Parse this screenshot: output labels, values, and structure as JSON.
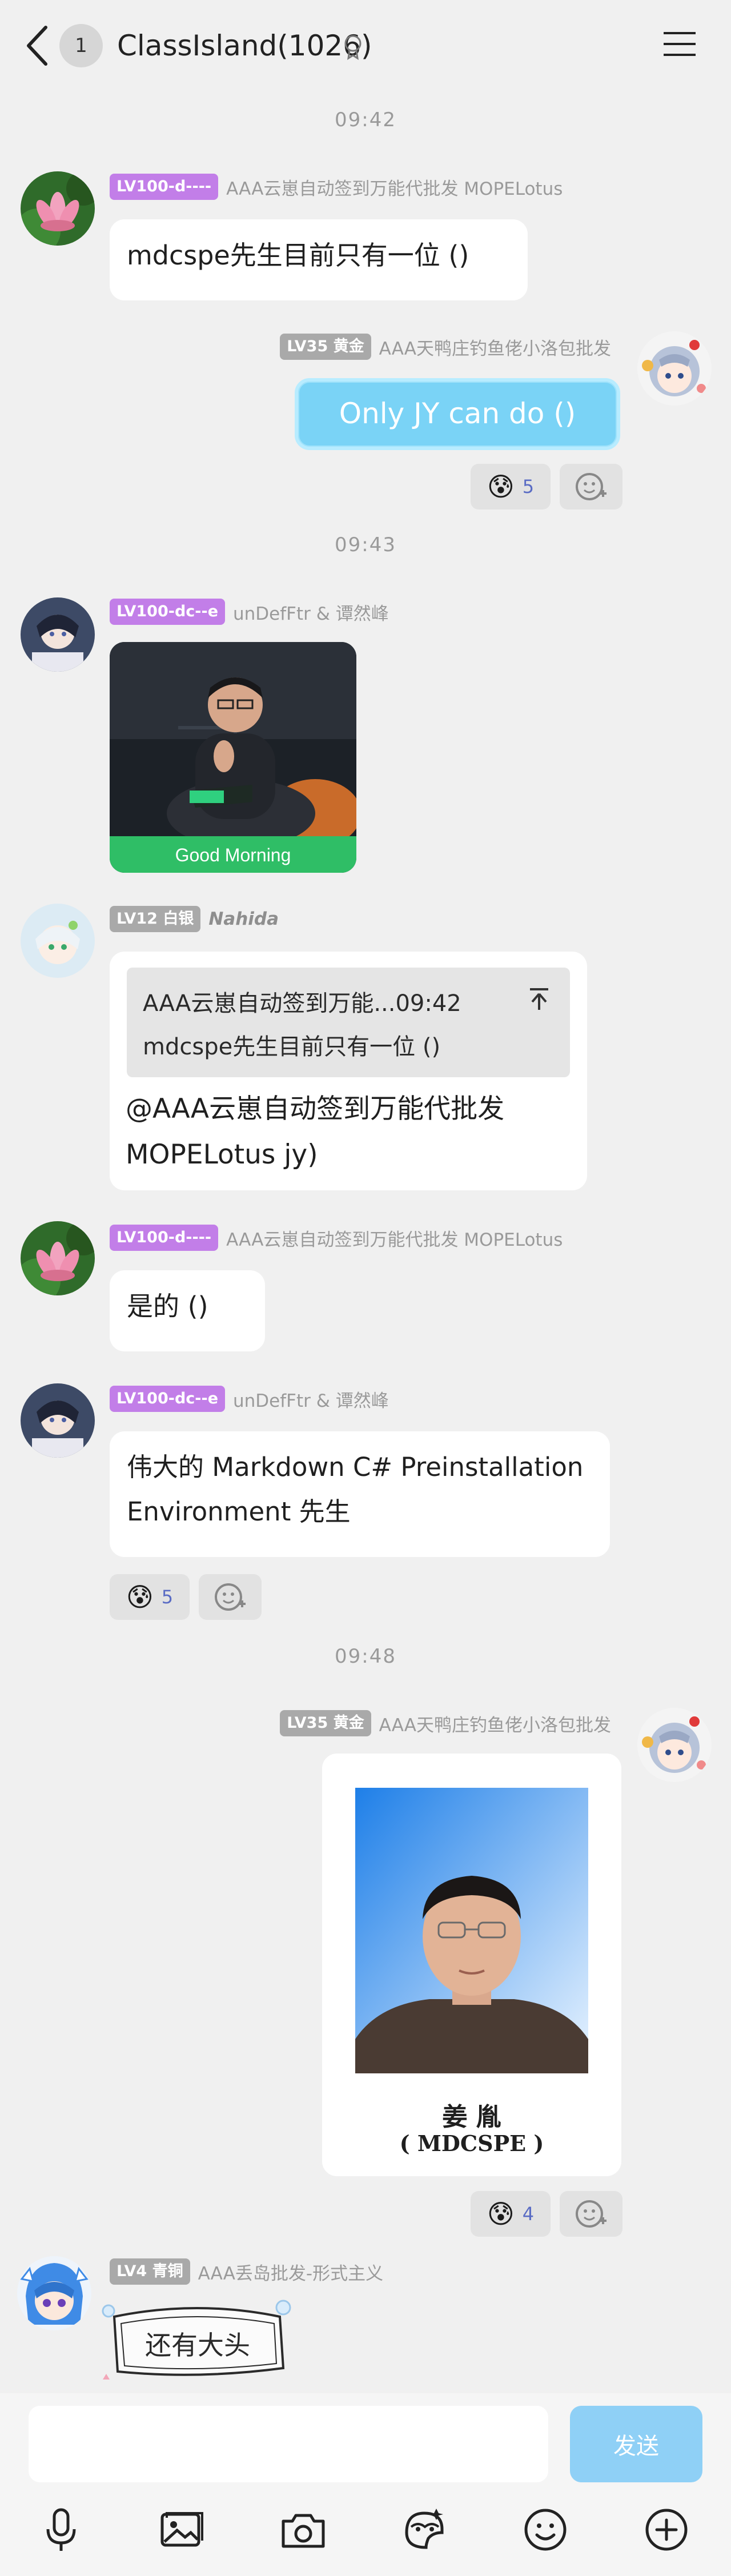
{
  "header": {
    "unread_count": "1",
    "title": "ClassIsland(1026)"
  },
  "timestamps": [
    "09:42",
    "09:43",
    "09:48"
  ],
  "messages": [
    {
      "level": "LV100-d----",
      "nickname": "AAA云崽自动签到万能代批发 MOPELotus",
      "text": "mdcspe先生目前只有一位 ()"
    },
    {
      "level": "LV35 黄金",
      "nickname": "AAA天鸭庄钓鱼佬小洛包批发",
      "text": "Only JY can do ()",
      "reaction": {
        "emoji": "😰",
        "count": "5"
      }
    },
    {
      "level": "LV100-dc--e",
      "nickname": "unDefFtr & 谭然峰",
      "image_caption": "Good Morning"
    },
    {
      "level": "LV12 白银",
      "nickname": "Nahida",
      "quote_header": "AAA云崽自动签到万能...09:42",
      "quote_text": "mdcspe先生目前只有一位 ()",
      "text_line1": "@AAA云崽自动签到万能代批发",
      "text_line2": "MOPELotus jy)"
    },
    {
      "level": "LV100-d----",
      "nickname": "AAA云崽自动签到万能代批发 MOPELotus",
      "text": "是的 ()"
    },
    {
      "level": "LV100-dc--e",
      "nickname": "unDefFtr & 谭然峰",
      "text_line1": "伟大的 Markdown C# Preinstallation",
      "text_line2": "Environment 先生",
      "reaction": {
        "emoji": "😰",
        "count": "5"
      }
    },
    {
      "level": "LV35 黄金",
      "nickname": "AAA天鸭庄钓鱼佬小洛包批发",
      "doc_name": "姜 胤",
      "doc_sub": "( MDCSPE )",
      "reaction": {
        "emoji": "😰",
        "count": "4"
      }
    },
    {
      "level": "LV4 青铜",
      "nickname": "AAA丢岛批发-形式主义",
      "sticker_text": "还有大头"
    }
  ],
  "composer": {
    "placeholder": "",
    "send_label": "发送"
  },
  "colors": {
    "background": "#f0f0f0",
    "level_purple": "#c27ee8",
    "level_gray": "#a9a9a9",
    "accent_blue": "#8fd0f6"
  },
  "icons": [
    "back-icon",
    "certification-icon",
    "menu-icon",
    "add-reaction-icon",
    "microphone-icon",
    "image-icon",
    "camera-icon",
    "sticker-icon",
    "emoji-icon",
    "plus-icon"
  ]
}
